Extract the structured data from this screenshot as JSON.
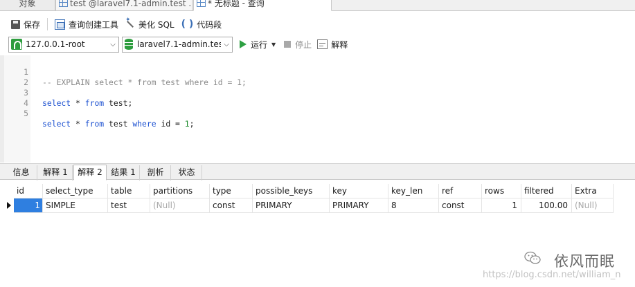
{
  "tabs": {
    "objects": "对象",
    "tab1": "test @laravel7.1-admin.test ...",
    "tab2": "* 无标题 - 查询"
  },
  "toolbar": {
    "save": "保存",
    "query_builder": "查询创建工具",
    "beautify": "美化 SQL",
    "snippet_icon": "( )",
    "snippet": "代码段"
  },
  "connection_bar": {
    "connection": "127.0.0.1-root",
    "database": "laravel7.1-admin.tes",
    "run": "运行",
    "stop": "停止",
    "explain": "解释"
  },
  "editor": {
    "line_numbers": [
      "1",
      "2",
      "3",
      "4",
      "5"
    ],
    "line1_comment": "-- EXPLAIN select * from test where id = 1;",
    "line3": {
      "kw1": "select",
      "p1": " * ",
      "kw2": "from",
      "p2": " test;"
    },
    "line5": {
      "kw1": "select",
      "p1": " * ",
      "kw2": "from",
      "p2": " test ",
      "kw3": "where",
      "p3": " id = ",
      "num": "1",
      "p4": ";"
    }
  },
  "result_tabs": [
    "信息",
    "解释 1",
    "解释 2",
    "结果 1",
    "剖析",
    "状态"
  ],
  "active_result_tab": "解释 2",
  "grid": {
    "columns": [
      "id",
      "select_type",
      "table",
      "partitions",
      "type",
      "possible_keys",
      "key",
      "key_len",
      "ref",
      "rows",
      "filtered",
      "Extra"
    ],
    "rows": [
      [
        "1",
        "SIMPLE",
        "test",
        "(Null)",
        "const",
        "PRIMARY",
        "PRIMARY",
        "8",
        "const",
        "1",
        "100.00",
        "(Null)"
      ]
    ]
  },
  "watermark": {
    "name": "依风而眠",
    "url": "https://blog.csdn.net/william_n"
  },
  "colors": {
    "keyword": "#1a4fd0",
    "comment": "#8a8a8a",
    "number": "#1a8a2a",
    "selection": "#2f7fe0",
    "run_green": "#2ea043",
    "null_text": "#a8a8a8"
  },
  "icons": {
    "save": "save-icon",
    "query_builder": "query-builder-icon",
    "beautify": "beautify-icon",
    "snippet": "code-snippet-icon",
    "connection": "connection-icon",
    "database": "database-icon",
    "run": "play-icon",
    "stop": "stop-icon",
    "explain": "explain-icon",
    "row_pointer": "row-pointer-icon",
    "watermark": "wechat-icon"
  }
}
